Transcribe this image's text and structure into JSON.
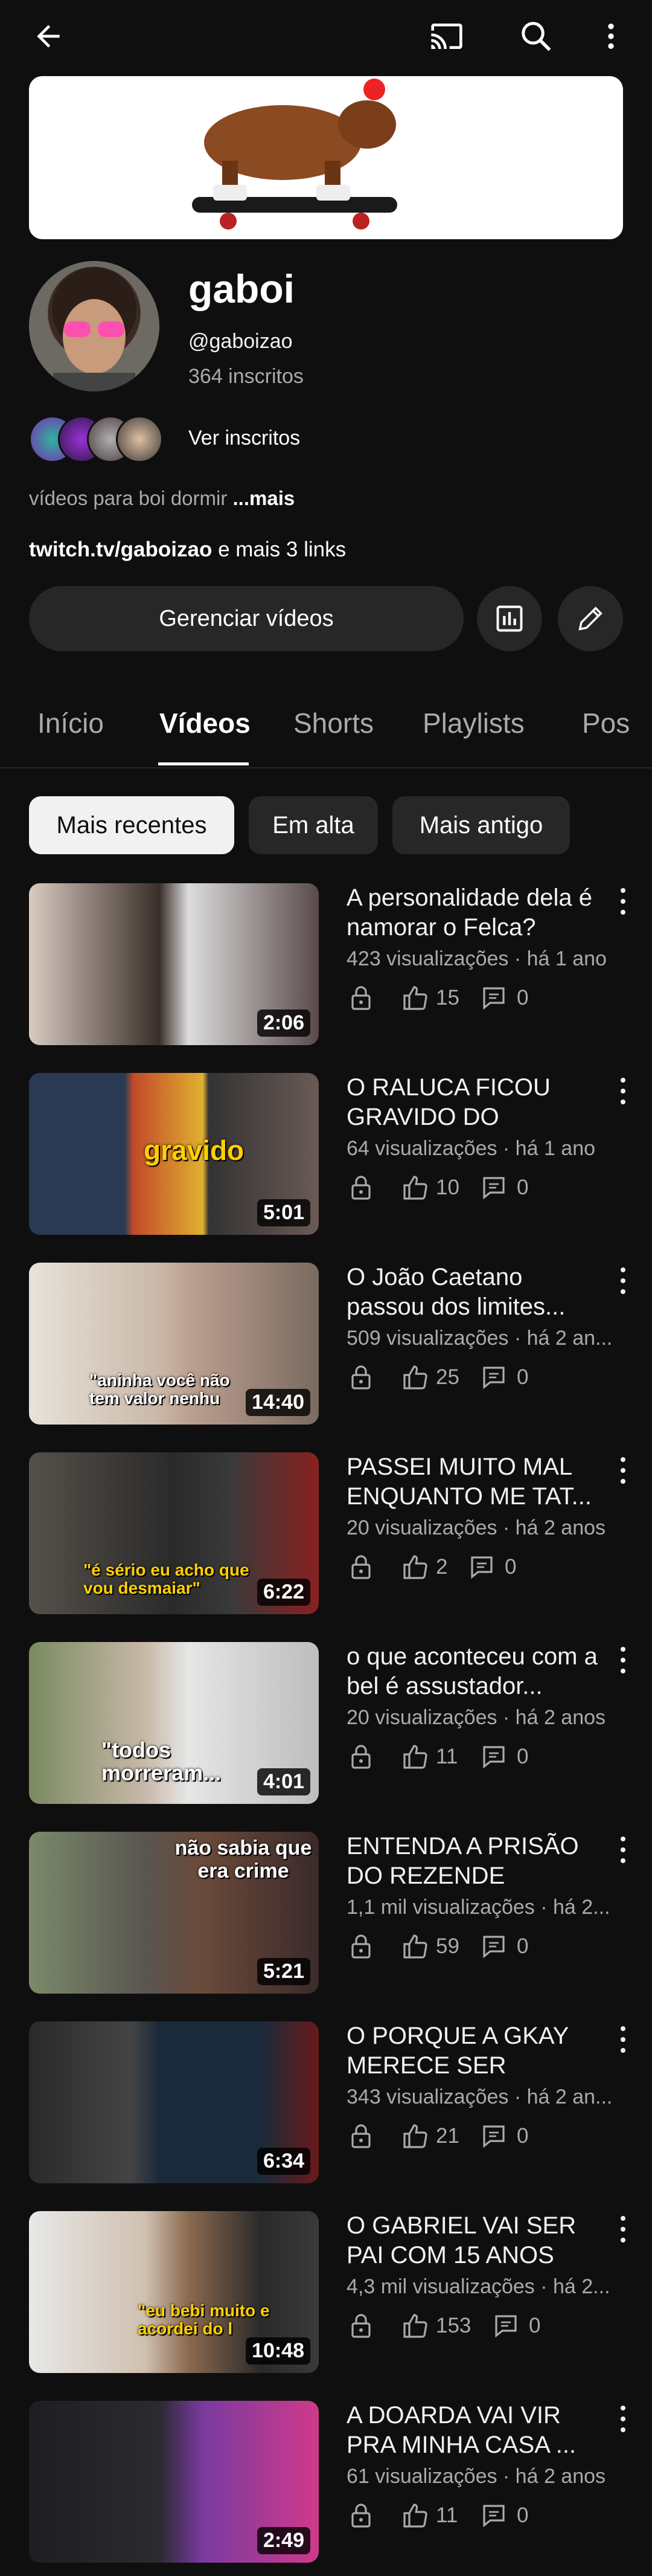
{
  "channel": {
    "name": "gaboi",
    "handle": "@gaboizao",
    "subscribers": "364 inscritos",
    "see_subscribers": "Ver inscritos",
    "description": "vídeos para boi dormir",
    "description_more": "...mais",
    "links_main": "twitch.tv/gaboizao",
    "links_rest": " e mais 3 links",
    "manage_button": "Gerenciar vídeos"
  },
  "tabs": [
    "Início",
    "Vídeos",
    "Shorts",
    "Playlists",
    "Pos"
  ],
  "chips": [
    "Mais recentes",
    "Em alta",
    "Mais antigo"
  ],
  "videos": [
    {
      "title": "A personalidade dela é namorar o Felca?",
      "meta": "423 visualizações · há 1 ano",
      "likes": "15",
      "comments": "0",
      "duration": "2:06"
    },
    {
      "title": "O RALUCA FICOU GRAVIDO DO JEANL...",
      "meta": "64 visualizações · há 1 ano",
      "likes": "10",
      "comments": "0",
      "duration": "5:01",
      "caption": "gravido"
    },
    {
      "title": "O João Caetano passou dos limites...",
      "meta": "509 visualizações · há 2 an...",
      "likes": "25",
      "comments": "0",
      "duration": "14:40",
      "caption": "\"aninha você não tem valor nenhu"
    },
    {
      "title": "PASSEI MUITO MAL ENQUANTO ME TAT...",
      "meta": "20 visualizações · há 2 anos",
      "likes": "2",
      "comments": "0",
      "duration": "6:22",
      "caption": "\"é sério eu acho que vou desmaiar\""
    },
    {
      "title": "o que aconteceu com a bel é assustador...",
      "meta": "20 visualizações · há 2 anos",
      "likes": "11",
      "comments": "0",
      "duration": "4:01",
      "caption": "\"todos morreram..."
    },
    {
      "title": "ENTENDA A PRISÃO DO REZENDE",
      "meta": "1,1 mil visualizações · há 2...",
      "likes": "59",
      "comments": "0",
      "duration": "5:21",
      "caption": "não sabia que era crime"
    },
    {
      "title": "O PORQUE A GKAY MERECE SER CANC...",
      "meta": "343 visualizações · há 2 an...",
      "likes": "21",
      "comments": "0",
      "duration": "6:34"
    },
    {
      "title": "O GABRIEL VAI SER PAI COM 15 ANOS",
      "meta": "4,3 mil visualizações · há 2...",
      "likes": "153",
      "comments": "0",
      "duration": "10:48",
      "caption": "\"eu bebi muito e acordei do l"
    },
    {
      "title": "A DOARDA VAI VIR PRA MINHA CASA ...",
      "meta": "61 visualizações · há 2 anos",
      "likes": "11",
      "comments": "0",
      "duration": "2:49"
    }
  ],
  "icons": {
    "back": "arrow-left-icon",
    "cast": "cast-icon",
    "search": "search-icon",
    "more": "more-vert-icon",
    "analytics": "analytics-icon",
    "edit": "pencil-icon",
    "lock": "lock-icon",
    "like": "thumbs-up-icon",
    "comment": "comment-icon"
  },
  "colors": {
    "background": "#0f0f0f",
    "surface": "#272727",
    "text": "#f1f1f1",
    "secondary_text": "#aaaaaa",
    "accent_red": "#e53935"
  }
}
